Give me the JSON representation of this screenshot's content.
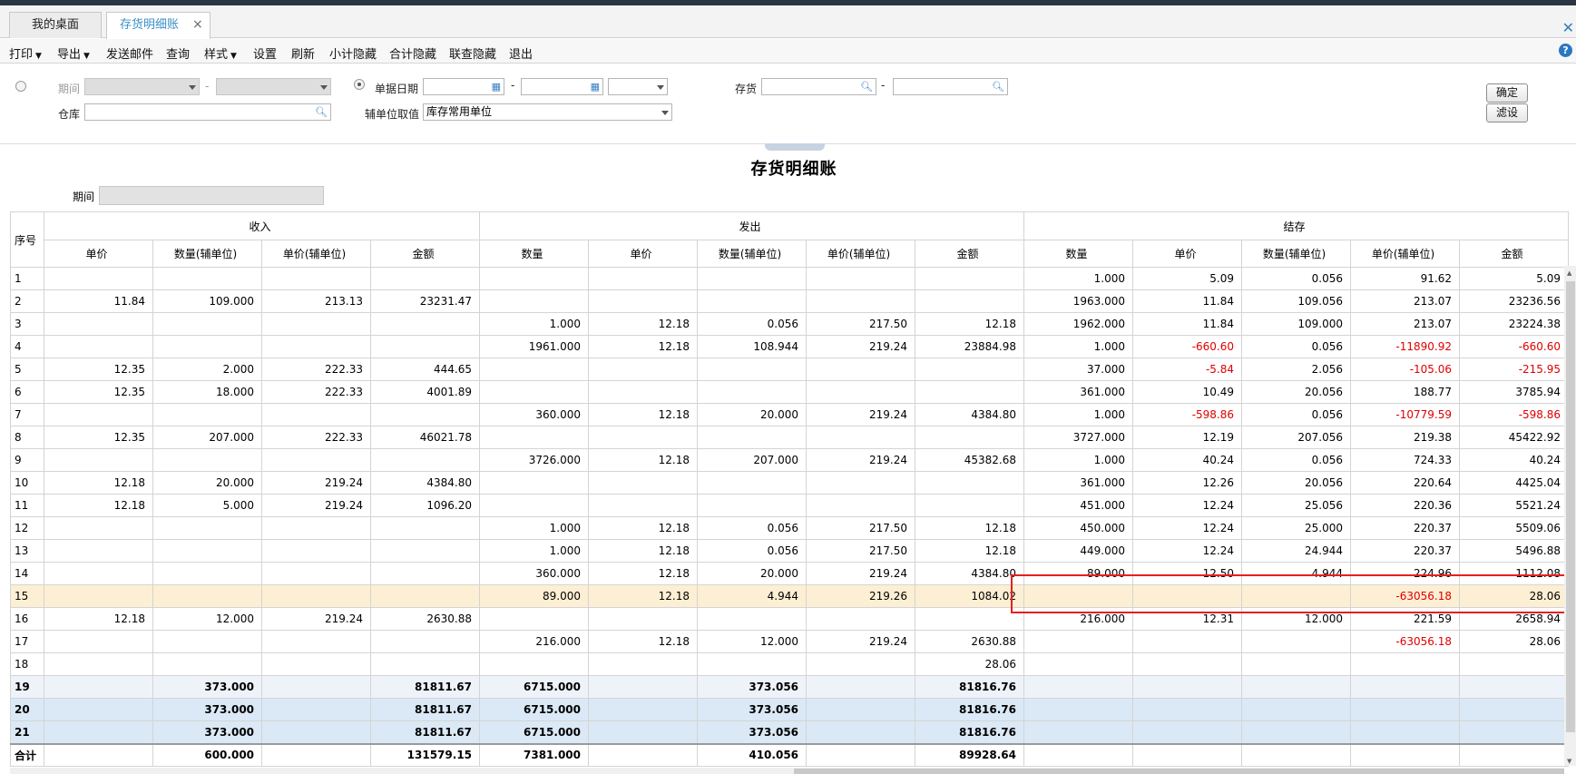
{
  "tabs": [
    {
      "label": "我的桌面"
    },
    {
      "label": "存货明细账",
      "active": true
    }
  ],
  "tab_close_symbol": "×",
  "window_close_symbol": "✕",
  "toolbar": {
    "items": [
      {
        "label": "打印",
        "dropdown": true
      },
      {
        "label": "导出",
        "dropdown": true
      },
      {
        "label": "发送邮件"
      },
      {
        "label": "查询"
      },
      {
        "label": "样式",
        "dropdown": true
      },
      {
        "label": "设置"
      },
      {
        "label": "刷新"
      },
      {
        "label": "小计隐藏"
      },
      {
        "label": "合计隐藏"
      },
      {
        "label": "联查隐藏"
      },
      {
        "label": "退出"
      }
    ],
    "help_symbol": "?"
  },
  "filter": {
    "period_label": "期间",
    "period_sep": "-",
    "doc_date_label": "单据日期",
    "date_sep": "-",
    "inventory_label": "存货",
    "inventory_sep": "-",
    "warehouse_label": "仓库",
    "aux_unit_label": "辅单位取值",
    "aux_unit_value": "库存常用单位",
    "confirm_label": "确定",
    "filter_label": "滤设"
  },
  "report": {
    "title": "存货明细账",
    "period_label": "期间"
  },
  "table": {
    "seq_header": "序号",
    "groups": [
      {
        "label": "收入",
        "span": 4
      },
      {
        "label": "发出",
        "span": 5
      },
      {
        "label": "结存",
        "span": 5
      }
    ],
    "columns": [
      "单价",
      "数量(辅单位)",
      "单价(辅单位)",
      "金额",
      "数量",
      "单价",
      "数量(辅单位)",
      "单价(辅单位)",
      "金额",
      "数量",
      "单价",
      "数量(辅单位)",
      "单价(辅单位)",
      "金额"
    ],
    "rows": [
      {
        "seq": "1",
        "cells": [
          "",
          "",
          "",
          "",
          "",
          "",
          "",
          "",
          "",
          "1.000",
          "5.09",
          "0.056",
          "91.62",
          "5.09"
        ]
      },
      {
        "seq": "2",
        "cells": [
          "11.84",
          "109.000",
          "213.13",
          "23231.47",
          "",
          "",
          "",
          "",
          "",
          "1963.000",
          "11.84",
          "109.056",
          "213.07",
          "23236.56"
        ]
      },
      {
        "seq": "3",
        "cells": [
          "",
          "",
          "",
          "",
          "1.000",
          "12.18",
          "0.056",
          "217.50",
          "12.18",
          "1962.000",
          "11.84",
          "109.000",
          "213.07",
          "23224.38"
        ]
      },
      {
        "seq": "4",
        "cells": [
          "",
          "",
          "",
          "",
          "1961.000",
          "12.18",
          "108.944",
          "219.24",
          "23884.98",
          "1.000",
          "-660.60",
          "0.056",
          "-11890.92",
          "-660.60"
        ]
      },
      {
        "seq": "5",
        "cells": [
          "12.35",
          "2.000",
          "222.33",
          "444.65",
          "",
          "",
          "",
          "",
          "",
          "37.000",
          "-5.84",
          "2.056",
          "-105.06",
          "-215.95"
        ]
      },
      {
        "seq": "6",
        "cells": [
          "12.35",
          "18.000",
          "222.33",
          "4001.89",
          "",
          "",
          "",
          "",
          "",
          "361.000",
          "10.49",
          "20.056",
          "188.77",
          "3785.94"
        ]
      },
      {
        "seq": "7",
        "cells": [
          "",
          "",
          "",
          "",
          "360.000",
          "12.18",
          "20.000",
          "219.24",
          "4384.80",
          "1.000",
          "-598.86",
          "0.056",
          "-10779.59",
          "-598.86"
        ]
      },
      {
        "seq": "8",
        "cells": [
          "12.35",
          "207.000",
          "222.33",
          "46021.78",
          "",
          "",
          "",
          "",
          "",
          "3727.000",
          "12.19",
          "207.056",
          "219.38",
          "45422.92"
        ]
      },
      {
        "seq": "9",
        "cells": [
          "",
          "",
          "",
          "",
          "3726.000",
          "12.18",
          "207.000",
          "219.24",
          "45382.68",
          "1.000",
          "40.24",
          "0.056",
          "724.33",
          "40.24"
        ]
      },
      {
        "seq": "10",
        "cells": [
          "12.18",
          "20.000",
          "219.24",
          "4384.80",
          "",
          "",
          "",
          "",
          "",
          "361.000",
          "12.26",
          "20.056",
          "220.64",
          "4425.04"
        ]
      },
      {
        "seq": "11",
        "cells": [
          "12.18",
          "5.000",
          "219.24",
          "1096.20",
          "",
          "",
          "",
          "",
          "",
          "451.000",
          "12.24",
          "25.056",
          "220.36",
          "5521.24"
        ]
      },
      {
        "seq": "12",
        "cells": [
          "",
          "",
          "",
          "",
          "1.000",
          "12.18",
          "0.056",
          "217.50",
          "12.18",
          "450.000",
          "12.24",
          "25.000",
          "220.37",
          "5509.06"
        ]
      },
      {
        "seq": "13",
        "cells": [
          "",
          "",
          "",
          "",
          "1.000",
          "12.18",
          "0.056",
          "217.50",
          "12.18",
          "449.000",
          "12.24",
          "24.944",
          "220.37",
          "5496.88"
        ]
      },
      {
        "seq": "14",
        "cells": [
          "",
          "",
          "",
          "",
          "360.000",
          "12.18",
          "20.000",
          "219.24",
          "4384.80",
          "89.000",
          "12.50",
          "4.944",
          "224.96",
          "1112.08"
        ]
      },
      {
        "seq": "15",
        "highlight": true,
        "cells": [
          "",
          "",
          "",
          "",
          "89.000",
          "12.18",
          "4.944",
          "219.26",
          "1084.02",
          "",
          "",
          "",
          "-63056.18",
          "28.06"
        ]
      },
      {
        "seq": "16",
        "cells": [
          "12.18",
          "12.000",
          "219.24",
          "2630.88",
          "",
          "",
          "",
          "",
          "",
          "216.000",
          "12.31",
          "12.000",
          "221.59",
          "2658.94"
        ]
      },
      {
        "seq": "17",
        "cells": [
          "",
          "",
          "",
          "",
          "216.000",
          "12.18",
          "12.000",
          "219.24",
          "2630.88",
          "",
          "",
          "",
          "-63056.18",
          "28.06"
        ]
      },
      {
        "seq": "18",
        "cells": [
          "",
          "",
          "",
          "",
          "",
          "",
          "",
          "",
          "28.06",
          "",
          "",
          "",
          "",
          ""
        ]
      },
      {
        "seq": "19",
        "style": "sub",
        "cells": [
          "",
          "373.000",
          "",
          "81811.67",
          "6715.000",
          "",
          "373.056",
          "",
          "81816.76",
          "",
          "",
          "",
          "",
          ""
        ]
      },
      {
        "seq": "20",
        "style": "sub2",
        "cells": [
          "",
          "373.000",
          "",
          "81811.67",
          "6715.000",
          "",
          "373.056",
          "",
          "81816.76",
          "",
          "",
          "",
          "",
          ""
        ]
      },
      {
        "seq": "21",
        "style": "sub2",
        "cells": [
          "",
          "373.000",
          "",
          "81811.67",
          "6715.000",
          "",
          "373.056",
          "",
          "81816.76",
          "",
          "",
          "",
          "",
          ""
        ]
      }
    ],
    "total": {
      "seq": "合计",
      "cells": [
        "",
        "600.000",
        "",
        "131579.15",
        "7381.000",
        "",
        "410.056",
        "",
        "89928.64",
        "",
        "",
        "",
        "",
        ""
      ]
    }
  },
  "colors": {
    "negative": "#e00000",
    "highlight_row": "#fdefd3",
    "annotation_box": "#e42020",
    "active_tab_text": "#3a8fc8"
  }
}
